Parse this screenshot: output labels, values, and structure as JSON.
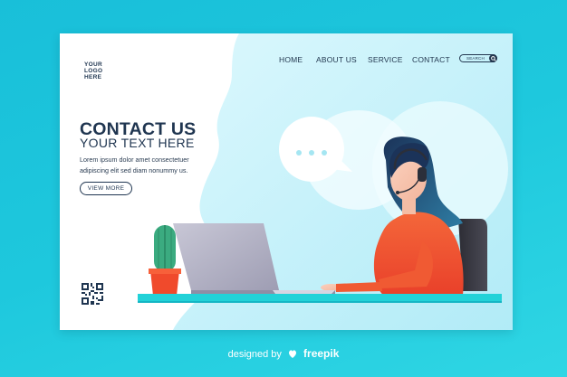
{
  "logo": {
    "lines": [
      "YOUR",
      "LOGO",
      "HERE"
    ]
  },
  "nav": {
    "items": [
      {
        "label": "HOME"
      },
      {
        "label": "ABOUT US"
      },
      {
        "label": "SERVICE"
      },
      {
        "label": "CONTACT"
      }
    ],
    "search_placeholder": "SEARCH",
    "search_icon": "search-icon"
  },
  "hero": {
    "title": "CONTACT US",
    "subtitle": "YOUR TEXT HERE",
    "body_lines": [
      "Lorem ipsum dolor amet consectetuer",
      "adipiscing elit sed diam nonummy us."
    ],
    "button_label": "VIEW MORE"
  },
  "speech_bubble": {
    "text": "..."
  },
  "footer": {
    "prefix": "designed by",
    "brand": "freepik"
  },
  "colors": {
    "background": "#19bfd9",
    "text_dark": "#1f3550",
    "blob": "#cdf3fb",
    "desk": "#22d2d8",
    "shirt": "#f2542f",
    "hair": "#1e3b63",
    "cactus_pot": "#f04a2c",
    "cactus": "#3bab80",
    "laptop": "#b5b4c8"
  }
}
